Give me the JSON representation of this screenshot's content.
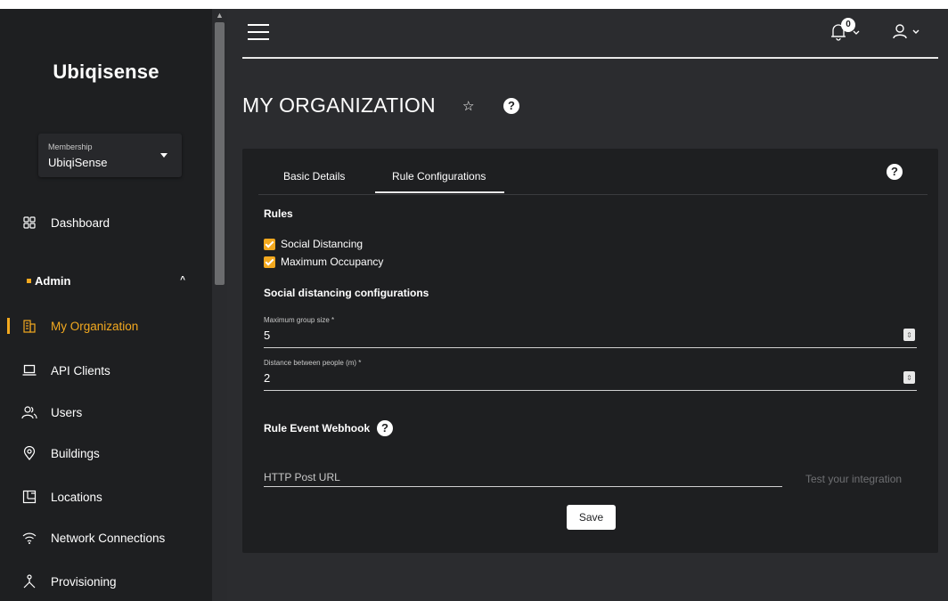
{
  "app": {
    "brand": "Ubiqisense"
  },
  "membership": {
    "label": "Membership",
    "value": "UbiqiSense"
  },
  "sidebar": {
    "items": [
      {
        "label": "Dashboard",
        "icon": "dashboard-icon"
      },
      {
        "label": "My Organization",
        "icon": "building-icon",
        "active": true
      },
      {
        "label": "API Clients",
        "icon": "laptop-icon"
      },
      {
        "label": "Users",
        "icon": "users-icon"
      },
      {
        "label": "Buildings",
        "icon": "location-pin-icon"
      },
      {
        "label": "Locations",
        "icon": "floorplan-icon"
      },
      {
        "label": "Network Connections",
        "icon": "wifi-icon"
      },
      {
        "label": "Provisioning",
        "icon": "provisioning-icon"
      }
    ],
    "admin_label": "Admin"
  },
  "header": {
    "notification_count": "0"
  },
  "page": {
    "title": "MY ORGANIZATION"
  },
  "tabs": [
    {
      "label": "Basic Details"
    },
    {
      "label": "Rule Configurations",
      "active": true
    }
  ],
  "rules": {
    "title": "Rules",
    "items": [
      {
        "label": "Social Distancing",
        "checked": true
      },
      {
        "label": "Maximum Occupancy",
        "checked": true
      }
    ]
  },
  "social_distancing": {
    "title": "Social distancing configurations",
    "max_group_size": {
      "label": "Maximum group size *",
      "value": "5"
    },
    "distance": {
      "label": "Distance between people (m) *",
      "value": "2"
    }
  },
  "webhook": {
    "title": "Rule Event Webhook",
    "url_placeholder": "HTTP Post URL",
    "test_label": "Test your integration",
    "save_label": "Save"
  },
  "colors": {
    "accent": "#f3a91f",
    "sidebar_bg": "#1e1f21",
    "main_bg": "#2b2c2f"
  }
}
